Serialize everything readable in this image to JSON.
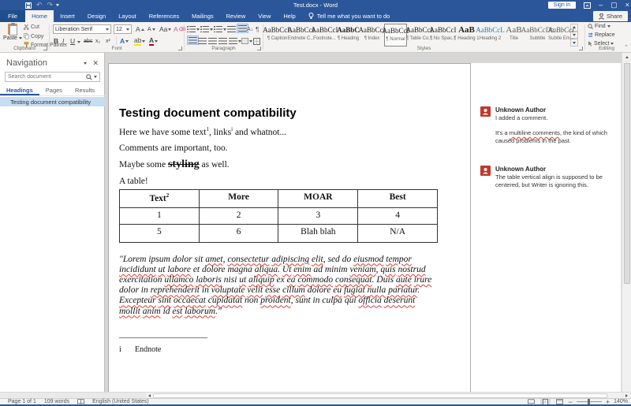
{
  "titlebar": {
    "title": "Test.docx - Word",
    "sign_in_label": "Sign in"
  },
  "tabs": [
    "File",
    "Home",
    "Insert",
    "Design",
    "Layout",
    "References",
    "Mailings",
    "Review",
    "View",
    "Help"
  ],
  "tell_me_label": "Tell me what you want to do",
  "share_label": "Share",
  "ribbon": {
    "clipboard": {
      "label": "Clipboard",
      "paste": "Paste",
      "cut": "Cut",
      "copy": "Copy",
      "format_painter": "Format Painter"
    },
    "font": {
      "label": "Font",
      "name_value": "Liberation Serif",
      "size_value": "12",
      "bold": "B",
      "italic": "I",
      "underline": "U",
      "strikethrough": "abc",
      "subscript": "x₂",
      "superscript": "x²",
      "change_case": "Aa",
      "grow": "A",
      "shrink": "A",
      "effects": "A",
      "highlight": "ab",
      "color": "A"
    },
    "paragraph": {
      "label": "Paragraph",
      "pilcrow": "¶",
      "sort": "A↓"
    },
    "styles": {
      "label": "Styles",
      "items": [
        {
          "sample": "AaBbCcL",
          "name": "¶ Caption"
        },
        {
          "sample": "AaBbCcI",
          "name": "Endnote C..."
        },
        {
          "sample": "AaBbCcI",
          "name": "Footnote..."
        },
        {
          "sample": "AaBbC",
          "name": "¶ Heading"
        },
        {
          "sample": "AaBbCcI",
          "name": "¶ Index"
        },
        {
          "sample": "AaBbCcI",
          "name": "¶ Normal"
        },
        {
          "sample": "AaBbCcI",
          "name": "¶ Table Co..."
        },
        {
          "sample": "AaBbCcI",
          "name": "¶ No Spac..."
        },
        {
          "sample": "AaB",
          "name": "¶ Heading 1"
        },
        {
          "sample": "AaBbCcL",
          "name": "Heading 2"
        },
        {
          "sample": "AaB",
          "name": "Title"
        },
        {
          "sample": "AaBbCcDc",
          "name": "Subtitle"
        },
        {
          "sample": "AaBbCcI",
          "name": "Subtle Em..."
        }
      ]
    },
    "editing": {
      "label": "Editing",
      "find": "Find",
      "replace": "Replace",
      "select": "Select"
    }
  },
  "navigation": {
    "title": "Navigation",
    "search_placeholder": "Search document",
    "tabs": [
      "Headings",
      "Pages",
      "Results"
    ],
    "items": [
      "Testing document compatibility"
    ]
  },
  "document": {
    "heading": "Testing document compatibility",
    "para1": {
      "t1": "Here we have some text",
      "sup1": "1",
      "t2": ", links",
      "sup2": "i",
      "t3": " and whatnot..."
    },
    "para2": "Comments are important, too.",
    "para3": {
      "t1": "Maybe some ",
      "styled": "styling",
      "t2": " as well."
    },
    "table_intro": "A table!",
    "table": {
      "headers": {
        "col1": "Text",
        "col1_sup": "2",
        "col2": "More",
        "col3": "MOAR",
        "col4": "Best"
      },
      "rows": [
        [
          "1",
          "2",
          "3",
          "4"
        ],
        [
          "5",
          "6",
          "Blah blah",
          "N/A"
        ]
      ]
    },
    "lorem": {
      "text": "\"Lorem ipsum dolor sit amet, consectetur adipiscing elit, sed do eiusmod tempor incididunt ut labore et dolore magna aliqua. Ut enim ad minim veniam, quis nostrud exercitation ullamco laboris nisi ut aliquip ex ea commodo consequat. Duis aute irure dolor in reprehenderit in voluptate velit esse cillum dolore eu fugiat nulla pariatur. Excepteur sint occaecat cupidatat non proident, sunt in culpa qui officia deserunt mollit anim id est laborum.\"",
      "misspelled": [
        "amet",
        "consectetur",
        "adipiscing",
        "elit",
        "eiusmod",
        "tempor",
        "incididunt",
        "ut",
        "labore",
        "aliqua",
        "enim",
        "veniam",
        "quis",
        "nostrud",
        "ullamco",
        "laboris",
        "aliquip",
        "ea",
        "commodo",
        "consequat",
        "aute",
        "irure",
        "reprehenderit",
        "voluptate",
        "velit",
        "esse",
        "cillum",
        "eu",
        "fugiat",
        "nulla",
        "pariatur",
        "excepteur",
        "sint",
        "occaecat",
        "cupidatat",
        "proident",
        "officia",
        "deserunt",
        "mollit",
        "anim",
        "est",
        "laborum"
      ]
    },
    "endnote": {
      "marker": "i",
      "text": "Endnote"
    }
  },
  "comments": {
    "c1": {
      "author": "Unknown Author",
      "line1": "I added a comment.",
      "line2_pre": "It's a ",
      "line2_mis": "multiline comments",
      "line2_post": ", the kind of which caused problems in the past."
    },
    "c2": {
      "author": "Unknown Author",
      "text": "The table vertical align is supposed to be centered, but Writer is ignoring this."
    }
  },
  "statusbar": {
    "page": "Page 1 of 1",
    "words": "109 words",
    "language": "English (United States)",
    "zoom": "140%"
  },
  "colors": {
    "accent": "#2b579a",
    "comment_avatar": "#c0392b",
    "squiggle": "#e03c31",
    "nav_selection": "#c6ddf2"
  }
}
